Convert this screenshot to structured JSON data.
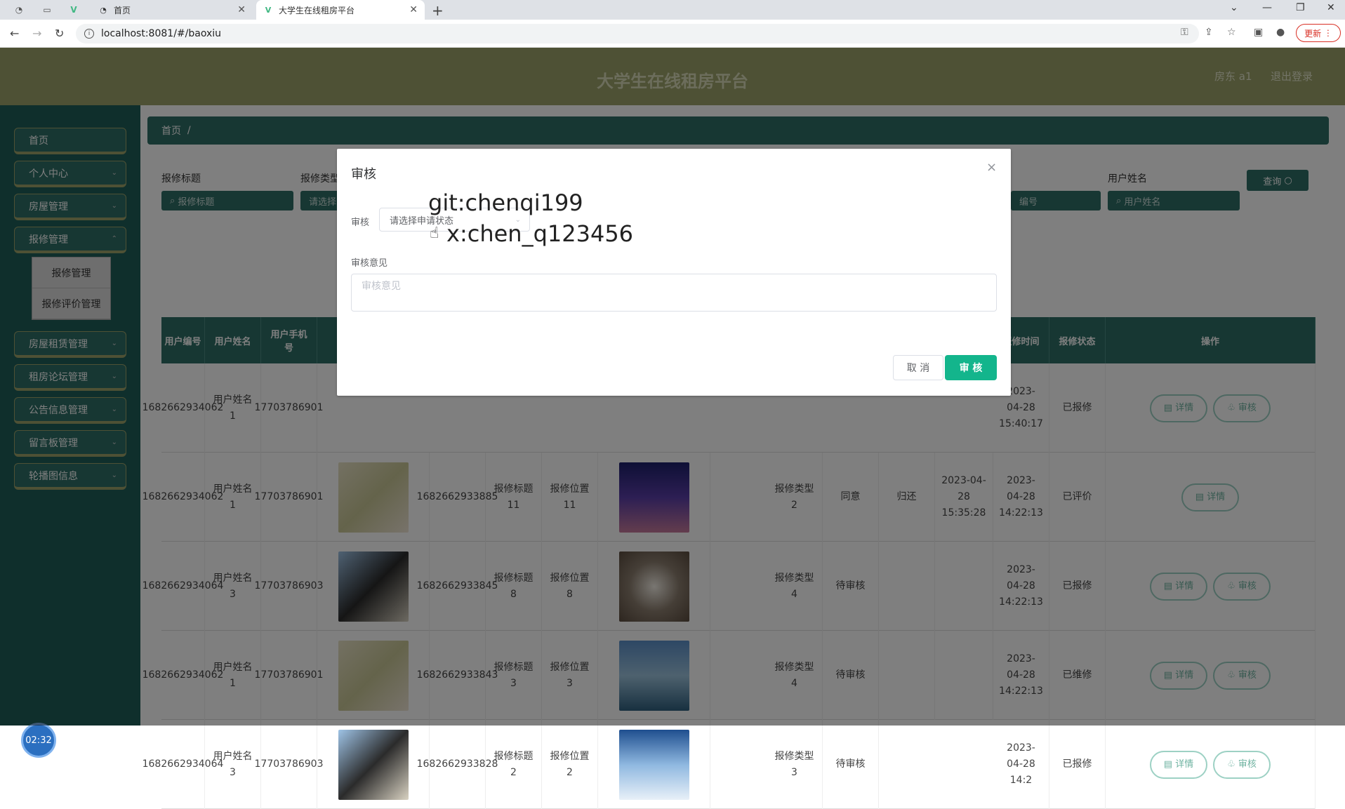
{
  "browser": {
    "tabs": [
      {
        "label": "首页"
      },
      {
        "label": "大学生在线租房平台"
      }
    ],
    "new_tab": "+",
    "url": "localhost:8081/#/baoxiu",
    "update_label": "更新"
  },
  "header": {
    "site_title": "大学生在线租房平台",
    "user": "房东 a1",
    "logout": "退出登录"
  },
  "sidebar": {
    "items": [
      {
        "label": "首页"
      },
      {
        "label": "个人中心"
      },
      {
        "label": "房屋管理"
      },
      {
        "label": "报修管理"
      },
      {
        "label": "房屋租赁管理"
      },
      {
        "label": "租房论坛管理"
      },
      {
        "label": "公告信息管理"
      },
      {
        "label": "留言板管理"
      },
      {
        "label": "轮播图信息"
      }
    ],
    "submenu": [
      {
        "label": "报修管理"
      },
      {
        "label": "报修评价管理"
      }
    ],
    "timer": "02:32"
  },
  "content": {
    "breadcrumb_home": "首页",
    "breadcrumb_sep": "/",
    "filters": {
      "title_label": "报修标题",
      "title_placeholder": "报修标题",
      "type_label": "报修类型",
      "type_placeholder": "请选择",
      "number_placeholder": "编号",
      "name_label": "用户姓名",
      "name_placeholder": "用户姓名",
      "query_button": "查询"
    },
    "table": {
      "headers": [
        "用户编号",
        "用户姓名",
        "用户手机号",
        "报修时间",
        "报修状态",
        "操作"
      ],
      "rows": [
        {
          "user_no": "1682662934062",
          "name": "用户姓名1",
          "phone": "17703786901",
          "title": "",
          "time": "2023-04-28 15:40:17",
          "status": "已报修",
          "buttons": [
            "详情",
            "审核"
          ]
        },
        {
          "user_no": "1682662934062",
          "name": "用户姓名1",
          "phone": "17703786901",
          "no": "1682662933885",
          "title": "报修标题11",
          "position": "报修位置11",
          "type": "报修类型2",
          "audit": "同意",
          "reply": "归还",
          "audit_time": "2023-04-28 15:35:28",
          "time": "2023-04-28 14:22:13",
          "status": "已评价",
          "buttons": [
            "详情"
          ]
        },
        {
          "user_no": "1682662934064",
          "name": "用户姓名3",
          "phone": "17703786903",
          "no": "1682662933845",
          "title": "报修标题8",
          "position": "报修位置8",
          "type": "报修类型4",
          "audit": "待审核",
          "reply": "",
          "audit_time": "",
          "time": "2023-04-28 14:22:13",
          "status": "已报修",
          "buttons": [
            "详情",
            "审核"
          ]
        },
        {
          "user_no": "1682662934062",
          "name": "用户姓名1",
          "phone": "17703786901",
          "no": "1682662933843",
          "title": "报修标题3",
          "position": "报修位置3",
          "type": "报修类型4",
          "audit": "待审核",
          "reply": "",
          "audit_time": "",
          "time": "2023-04-28 14:22:13",
          "status": "已维修",
          "buttons": [
            "详情",
            "审核"
          ]
        },
        {
          "user_no": "1682662934064",
          "name": "用户姓名3",
          "phone": "17703786903",
          "no": "1682662933828",
          "title": "报修标题2",
          "position": "报修位置2",
          "type": "报修类型3",
          "audit": "待审核",
          "reply": "",
          "audit_time": "",
          "time": "2023-04-28 14:2",
          "status": "已报修",
          "buttons": [
            "详情",
            "审核"
          ]
        }
      ]
    }
  },
  "dialog": {
    "title": "审核",
    "close": "×",
    "audit_label": "审核",
    "audit_placeholder": "请选择申请状态",
    "opinion_label": "审核意见",
    "opinion_placeholder": "审核意见",
    "cancel": "取 消",
    "confirm": "审 核"
  },
  "watermark": {
    "line1": "git:chenqi199",
    "line2": "x:chen_q123456"
  }
}
